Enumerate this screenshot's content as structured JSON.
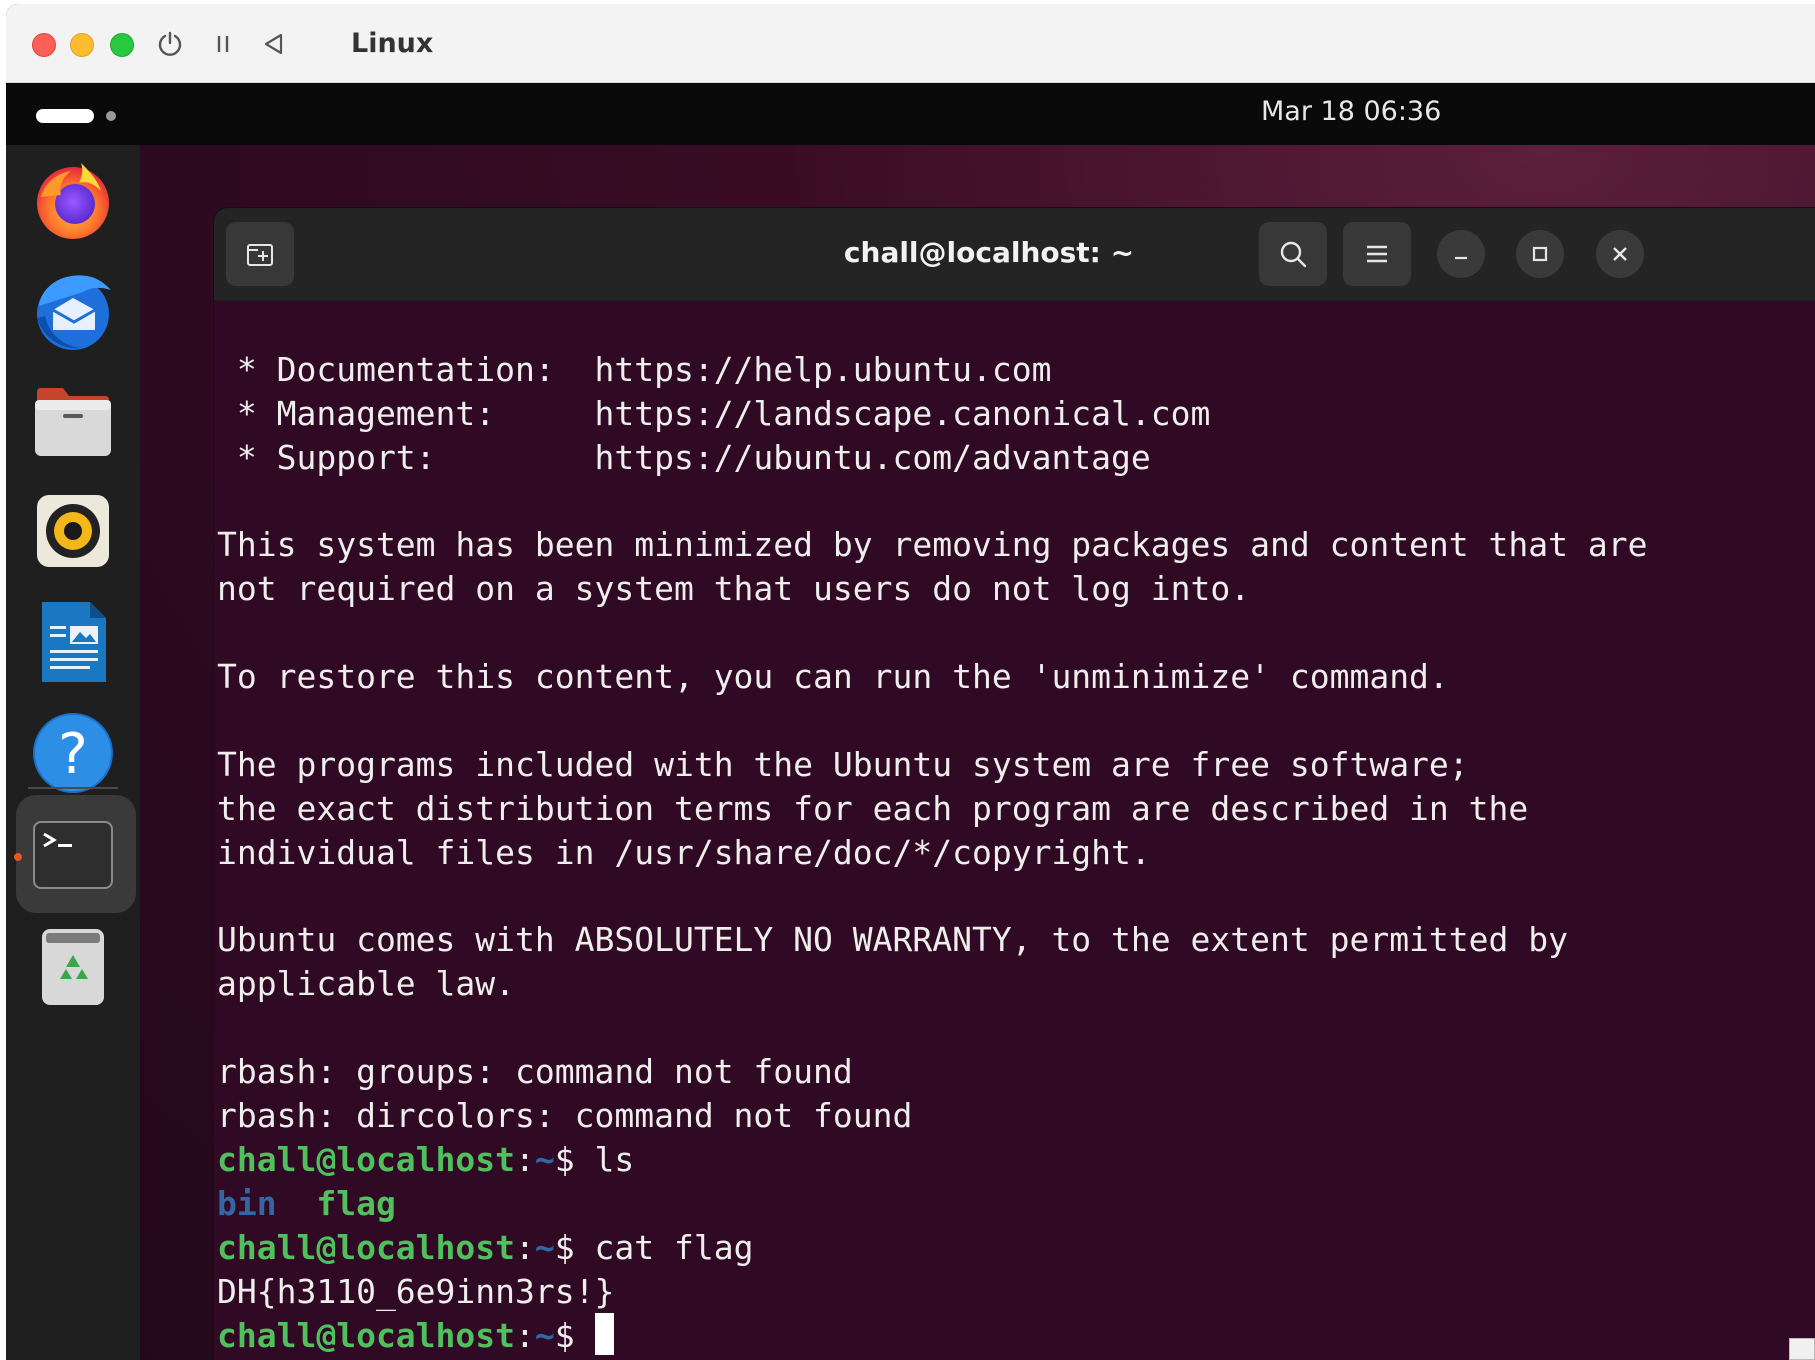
{
  "vm_window": {
    "title": "Linux",
    "controls": [
      "power-icon",
      "pause-icon",
      "back-icon"
    ]
  },
  "topbar": {
    "clock": "Mar 18  06:36"
  },
  "dock": {
    "apps": [
      {
        "name": "Firefox",
        "icon": "firefox-icon"
      },
      {
        "name": "Thunderbird",
        "icon": "thunderbird-icon"
      },
      {
        "name": "Files",
        "icon": "files-icon"
      },
      {
        "name": "Rhythmbox",
        "icon": "rhythmbox-icon"
      },
      {
        "name": "LibreOffice Writer",
        "icon": "writer-icon"
      },
      {
        "name": "Help",
        "icon": "help-icon"
      },
      {
        "name": "Terminal",
        "icon": "terminal-icon",
        "active": true
      },
      {
        "name": "Trash",
        "icon": "trash-icon"
      }
    ],
    "colors": {
      "active_indicator": "#e95420"
    }
  },
  "terminal": {
    "title": "chall@localhost: ~",
    "colors": {
      "background": "#300a24",
      "prompt_user": "#4ec15d",
      "prompt_path": "#3465a4",
      "text": "#eeeeec"
    },
    "lines": [
      "",
      " * Documentation:  https://help.ubuntu.com",
      " * Management:     https://landscape.canonical.com",
      " * Support:        https://ubuntu.com/advantage",
      "",
      "This system has been minimized by removing packages and content that are",
      "not required on a system that users do not log into.",
      "",
      "To restore this content, you can run the 'unminimize' command.",
      "",
      "The programs included with the Ubuntu system are free software;",
      "the exact distribution terms for each program are described in the",
      "individual files in /usr/share/doc/*/copyright.",
      "",
      "Ubuntu comes with ABSOLUTELY NO WARRANTY, to the extent permitted by",
      "applicable law.",
      "",
      "rbash: groups: command not found",
      "rbash: dircolors: command not found"
    ],
    "prompt": {
      "user_host": "chall@localhost",
      "sep": ":",
      "path": "~",
      "symbol": "$ "
    },
    "session": {
      "cmd_ls": "ls",
      "ls_dir": "bin",
      "ls_gap": "  ",
      "ls_file": "flag",
      "cmd_cat": "cat flag",
      "flag_output": "DH{h3110_6e9inn3rs!}"
    }
  }
}
